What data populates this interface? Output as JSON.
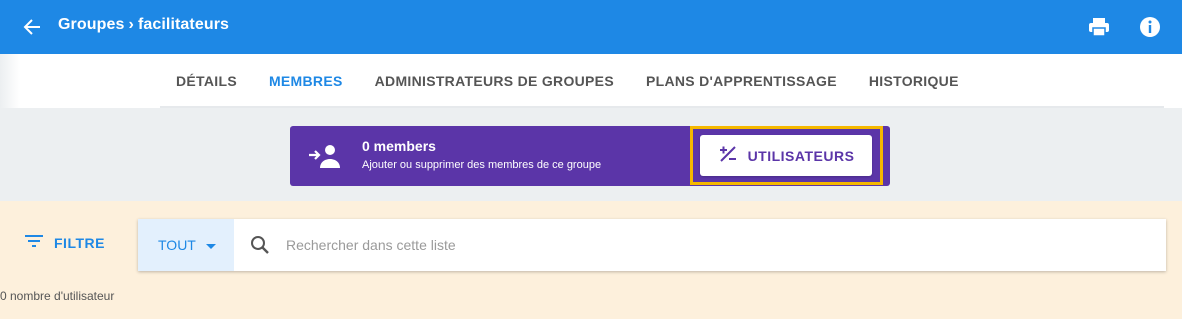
{
  "header": {
    "breadcrumb": [
      "Groupes",
      "facilitateurs"
    ],
    "separator": "›",
    "icons": [
      "back-arrow-icon",
      "print-icon",
      "info-icon"
    ],
    "color": "#1e88e5"
  },
  "tabs": [
    {
      "label": "DÉTAILS",
      "active": false
    },
    {
      "label": "MEMBRES",
      "active": true
    },
    {
      "label": "ADMINISTRATEURS DE GROUPES",
      "active": false
    },
    {
      "label": "PLANS D'APPRENTISSAGE",
      "active": false
    },
    {
      "label": "HISTORIQUE",
      "active": false
    }
  ],
  "members_card": {
    "title": "0 members",
    "subtitle": "Ajouter ou supprimer des membres de ce groupe",
    "button_label": "UTILISATEURS",
    "icon": "add-person-icon",
    "button_icon": "plus-minus-icon",
    "color": "#5b35a8",
    "highlight_color": "#f5b800"
  },
  "filter": {
    "label": "FILTRE",
    "icon": "filter-lines-icon"
  },
  "search": {
    "scope": "TOUT",
    "placeholder": "Rechercher dans cette liste",
    "value": ""
  },
  "user_count": "0 nombre d'utilisateur"
}
